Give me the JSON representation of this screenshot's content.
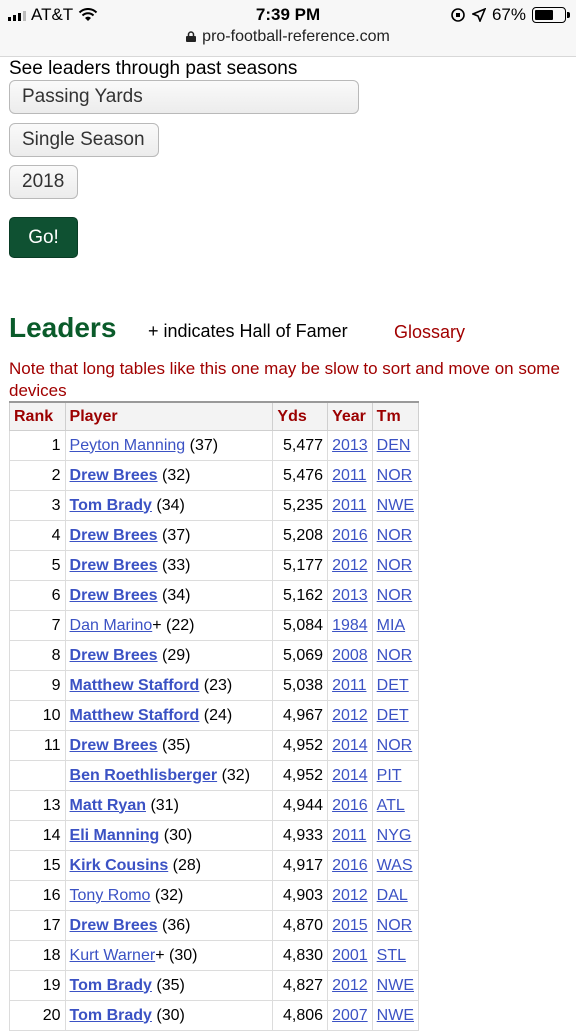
{
  "status": {
    "carrier": "AT&T",
    "time": "7:39 PM",
    "battery": "67%",
    "battery_level": 0.67,
    "url": "pro-football-reference.com"
  },
  "form": {
    "prompt": "See leaders through past seasons",
    "stat_select": "Passing Yards",
    "span_select": "Single Season",
    "year_select": "2018",
    "go_label": "Go!"
  },
  "leaders": {
    "title": "Leaders",
    "hof_note": "+ indicates Hall of Famer",
    "glossary": "Glossary",
    "note": "Note that long tables like this one may be slow to sort and move on some devices"
  },
  "table": {
    "headers": [
      "Rank",
      "Player",
      "Yds",
      "Year",
      "Tm"
    ],
    "rows": [
      {
        "rank": "1",
        "player": "Peyton Manning",
        "hof": "",
        "age": "(37)",
        "yds": "5,477",
        "year": "2013",
        "tm": "DEN",
        "active": false
      },
      {
        "rank": "2",
        "player": "Drew Brees",
        "hof": "",
        "age": "(32)",
        "yds": "5,476",
        "year": "2011",
        "tm": "NOR",
        "active": true
      },
      {
        "rank": "3",
        "player": "Tom Brady",
        "hof": "",
        "age": "(34)",
        "yds": "5,235",
        "year": "2011",
        "tm": "NWE",
        "active": true
      },
      {
        "rank": "4",
        "player": "Drew Brees",
        "hof": "",
        "age": "(37)",
        "yds": "5,208",
        "year": "2016",
        "tm": "NOR",
        "active": true
      },
      {
        "rank": "5",
        "player": "Drew Brees",
        "hof": "",
        "age": "(33)",
        "yds": "5,177",
        "year": "2012",
        "tm": "NOR",
        "active": true
      },
      {
        "rank": "6",
        "player": "Drew Brees",
        "hof": "",
        "age": "(34)",
        "yds": "5,162",
        "year": "2013",
        "tm": "NOR",
        "active": true
      },
      {
        "rank": "7",
        "player": "Dan Marino",
        "hof": "+",
        "age": "(22)",
        "yds": "5,084",
        "year": "1984",
        "tm": "MIA",
        "active": false
      },
      {
        "rank": "8",
        "player": "Drew Brees",
        "hof": "",
        "age": "(29)",
        "yds": "5,069",
        "year": "2008",
        "tm": "NOR",
        "active": true
      },
      {
        "rank": "9",
        "player": "Matthew Stafford",
        "hof": "",
        "age": "(23)",
        "yds": "5,038",
        "year": "2011",
        "tm": "DET",
        "active": true
      },
      {
        "rank": "10",
        "player": "Matthew Stafford",
        "hof": "",
        "age": "(24)",
        "yds": "4,967",
        "year": "2012",
        "tm": "DET",
        "active": true
      },
      {
        "rank": "11",
        "player": "Drew Brees",
        "hof": "",
        "age": "(35)",
        "yds": "4,952",
        "year": "2014",
        "tm": "NOR",
        "active": true
      },
      {
        "rank": "",
        "player": "Ben Roethlisberger",
        "hof": "",
        "age": "(32)",
        "yds": "4,952",
        "year": "2014",
        "tm": "PIT",
        "active": true
      },
      {
        "rank": "13",
        "player": "Matt Ryan",
        "hof": "",
        "age": "(31)",
        "yds": "4,944",
        "year": "2016",
        "tm": "ATL",
        "active": true
      },
      {
        "rank": "14",
        "player": "Eli Manning",
        "hof": "",
        "age": "(30)",
        "yds": "4,933",
        "year": "2011",
        "tm": "NYG",
        "active": true
      },
      {
        "rank": "15",
        "player": "Kirk Cousins",
        "hof": "",
        "age": "(28)",
        "yds": "4,917",
        "year": "2016",
        "tm": "WAS",
        "active": true
      },
      {
        "rank": "16",
        "player": "Tony Romo",
        "hof": "",
        "age": "(32)",
        "yds": "4,903",
        "year": "2012",
        "tm": "DAL",
        "active": false
      },
      {
        "rank": "17",
        "player": "Drew Brees",
        "hof": "",
        "age": "(36)",
        "yds": "4,870",
        "year": "2015",
        "tm": "NOR",
        "active": true
      },
      {
        "rank": "18",
        "player": "Kurt Warner",
        "hof": "+",
        "age": "(30)",
        "yds": "4,830",
        "year": "2001",
        "tm": "STL",
        "active": false
      },
      {
        "rank": "19",
        "player": "Tom Brady",
        "hof": "",
        "age": "(35)",
        "yds": "4,827",
        "year": "2012",
        "tm": "NWE",
        "active": true
      },
      {
        "rank": "20",
        "player": "Tom Brady",
        "hof": "",
        "age": "(30)",
        "yds": "4,806",
        "year": "2007",
        "tm": "NWE",
        "active": true
      }
    ]
  }
}
